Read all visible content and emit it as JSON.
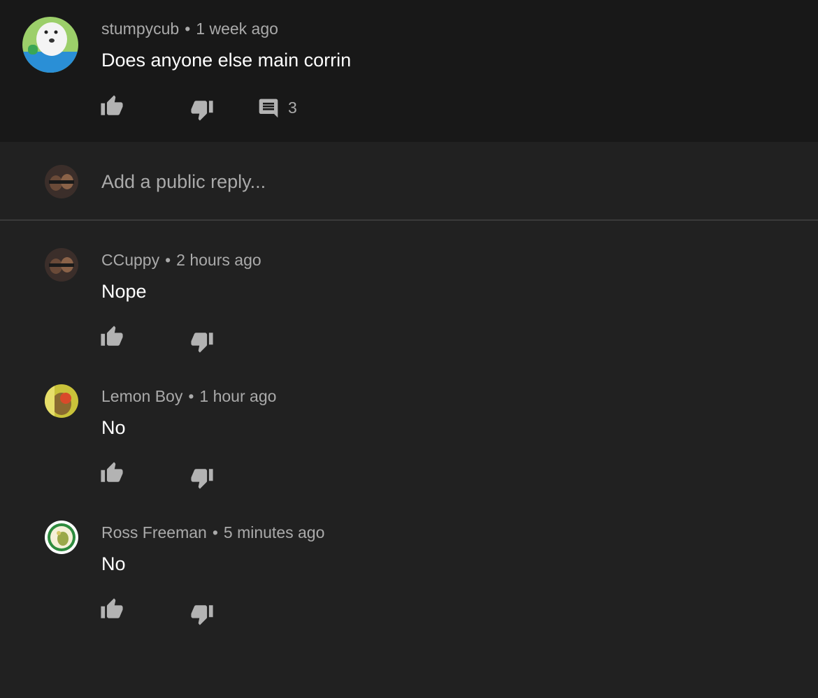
{
  "top_comment": {
    "author": "stumpycub",
    "time": "1 week ago",
    "text": "Does anyone else main corrin",
    "reply_count": "3",
    "icons": {
      "like": "thumbs-up-icon",
      "dislike": "thumbs-down-icon",
      "reply": "comment-icon"
    }
  },
  "reply_box": {
    "placeholder": "Add a public reply..."
  },
  "replies": [
    {
      "author": "CCuppy",
      "time": "2 hours ago",
      "text": "Nope"
    },
    {
      "author": "Lemon Boy",
      "time": "1 hour ago",
      "text": "No"
    },
    {
      "author": "Ross Freeman",
      "time": "5 minutes ago",
      "text": "No"
    }
  ],
  "colors": {
    "background": "#212121",
    "top_comment_background": "#181818",
    "secondary_text": "#aaaaaa",
    "primary_text": "#ffffff"
  }
}
